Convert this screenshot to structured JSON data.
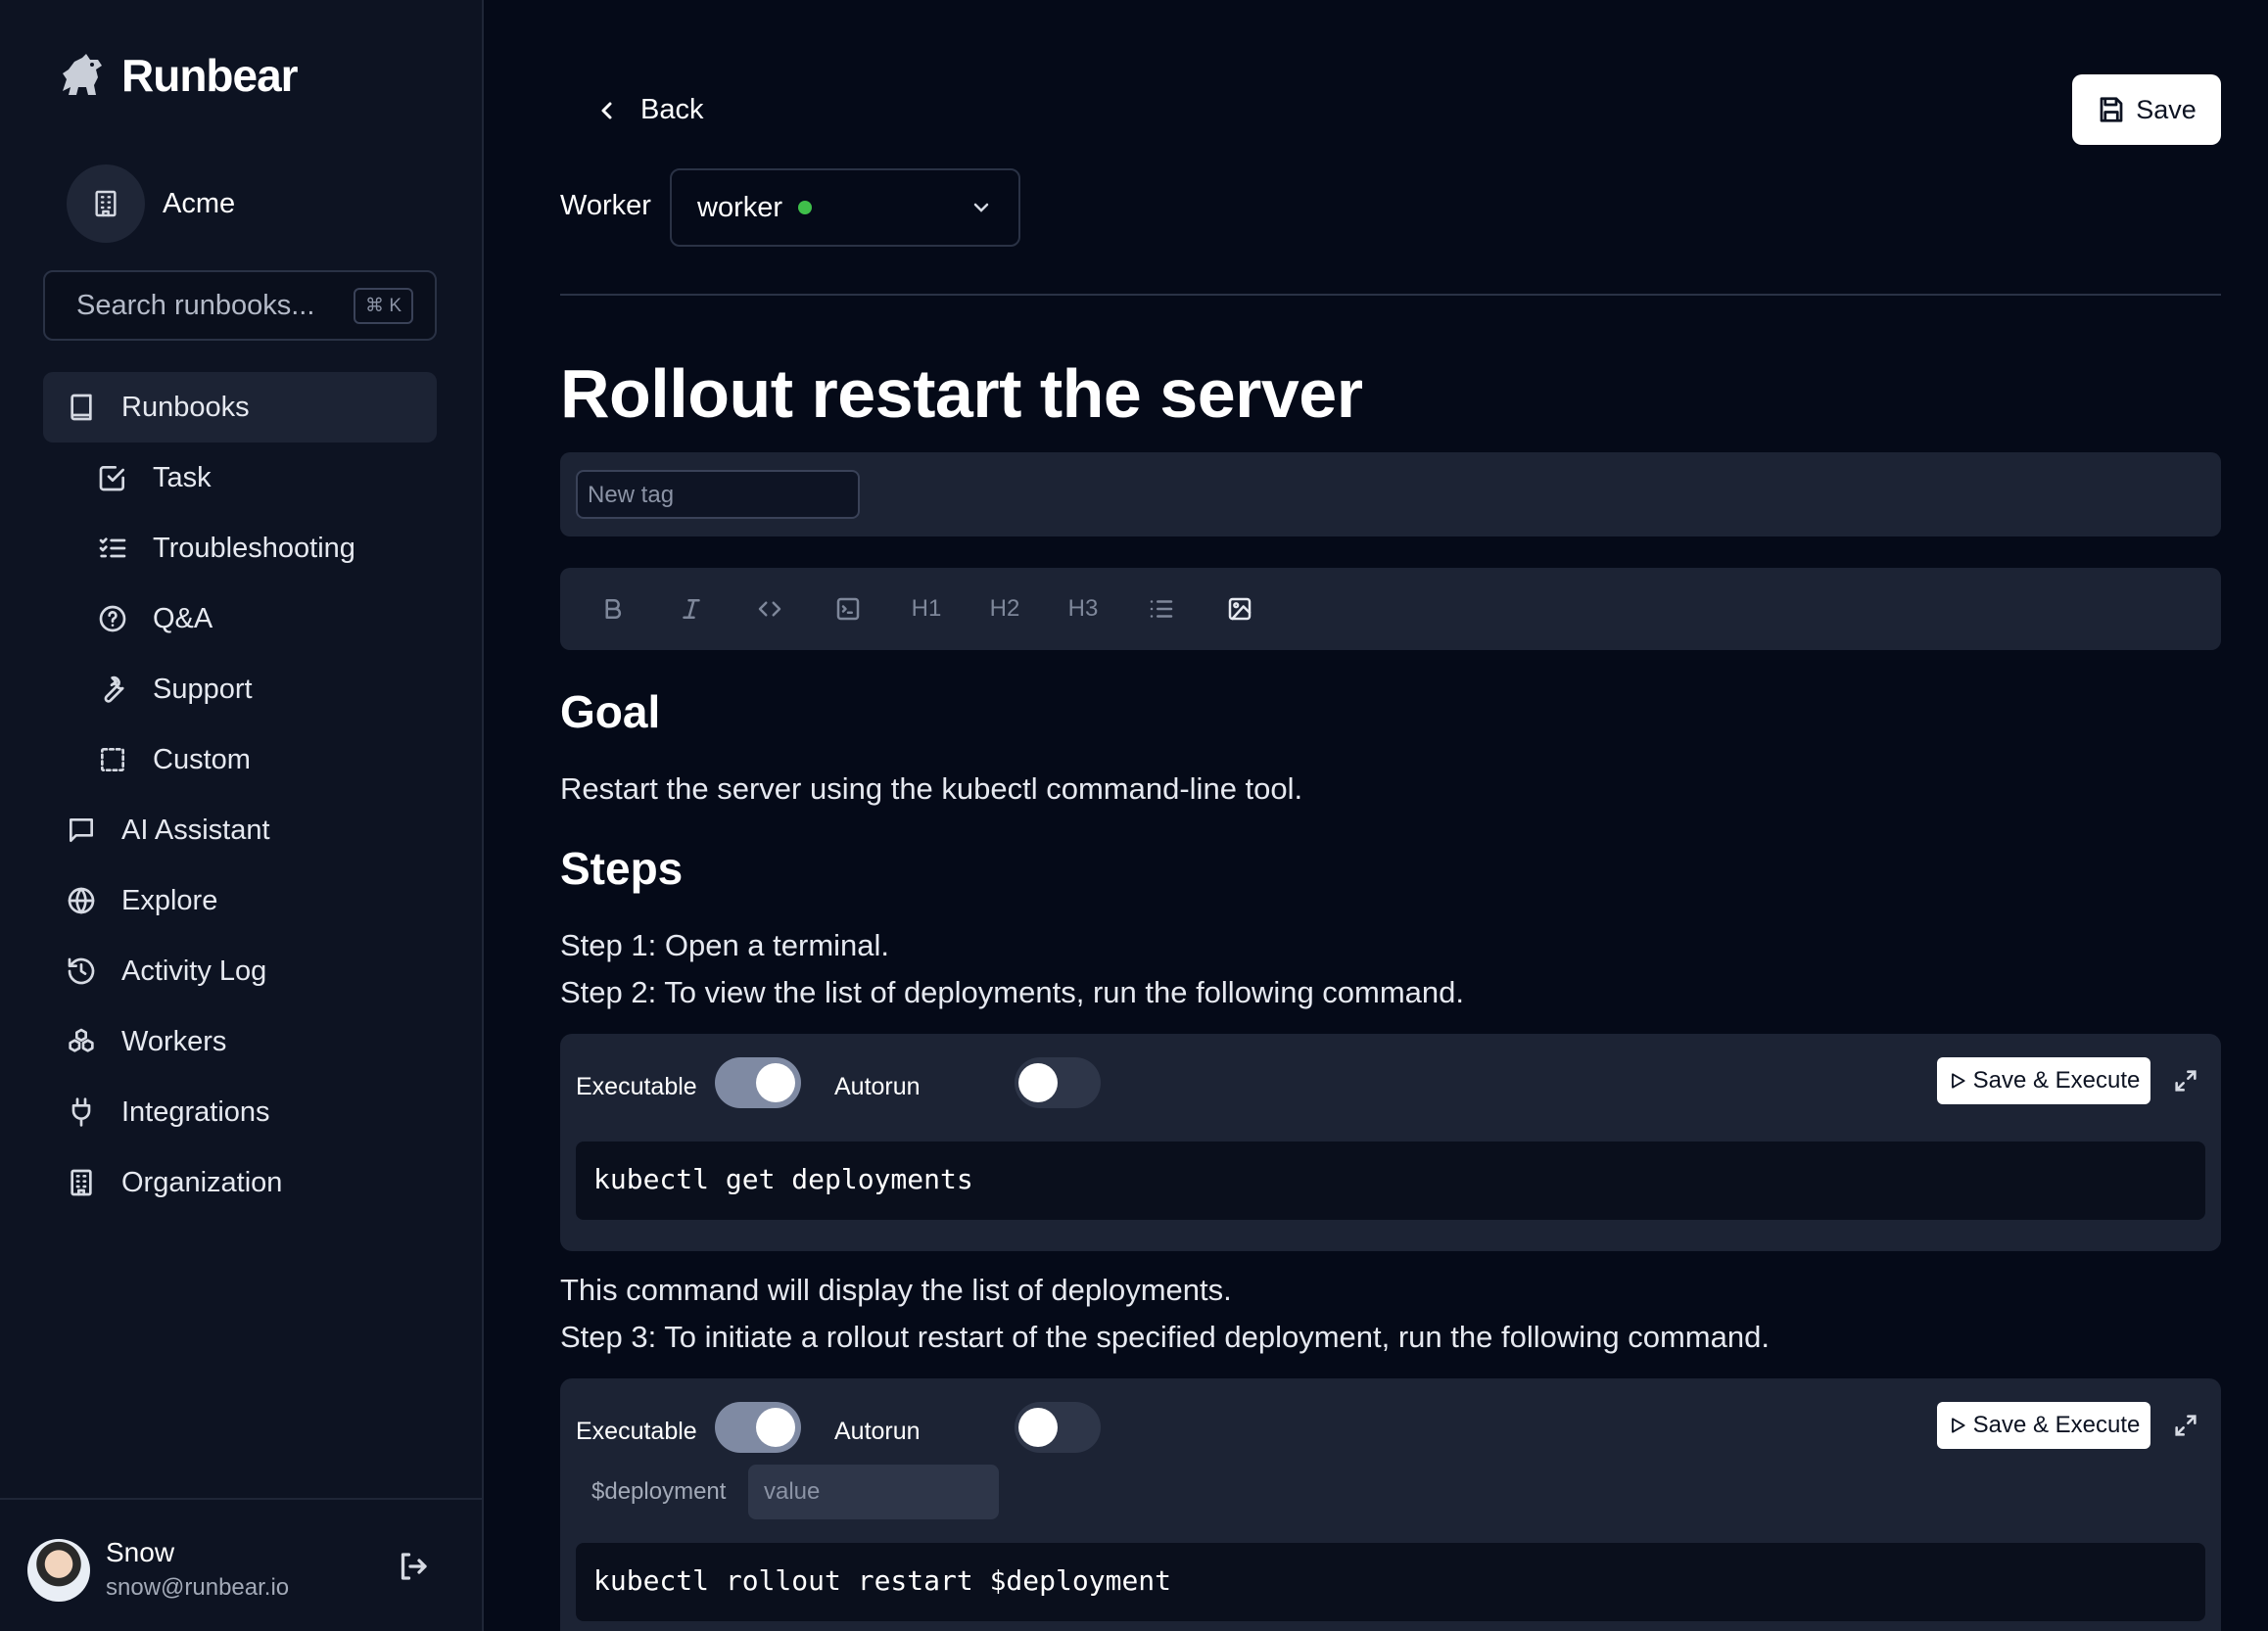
{
  "app": {
    "brand": "Runbear"
  },
  "sidebar": {
    "org_name": "Acme",
    "search": {
      "placeholder": "Search runbooks...",
      "shortcut": "⌘ K"
    },
    "items": [
      {
        "label": "Runbooks",
        "icon": "book-icon",
        "active": true
      },
      {
        "label": "Task",
        "icon": "checkbox-icon",
        "sub": true
      },
      {
        "label": "Troubleshooting",
        "icon": "list-checks-icon",
        "sub": true
      },
      {
        "label": "Q&A",
        "icon": "help-circle-icon",
        "sub": true
      },
      {
        "label": "Support",
        "icon": "wrench-icon",
        "sub": true
      },
      {
        "label": "Custom",
        "icon": "dashed-square-icon",
        "sub": true
      },
      {
        "label": "AI Assistant",
        "icon": "chat-icon"
      },
      {
        "label": "Explore",
        "icon": "globe-icon"
      },
      {
        "label": "Activity Log",
        "icon": "history-icon"
      },
      {
        "label": "Workers",
        "icon": "workers-icon"
      },
      {
        "label": "Integrations",
        "icon": "plug-icon"
      },
      {
        "label": "Organization",
        "icon": "building-icon"
      }
    ],
    "user": {
      "name": "Snow",
      "email": "snow@runbear.io"
    }
  },
  "header": {
    "back_label": "Back",
    "save_label": "Save",
    "worker_label": "Worker",
    "worker_value": "worker",
    "worker_status_color": "#3fbf4a"
  },
  "doc": {
    "title": "Rollout restart the server",
    "tag_placeholder": "New tag",
    "toolbar": [
      "bold-icon",
      "italic-icon",
      "code-icon",
      "terminal-icon",
      "H1",
      "H2",
      "H3",
      "bullet-list-icon",
      "image-icon"
    ],
    "goal_heading": "Goal",
    "goal_text": "Restart the server using the kubectl command-line tool.",
    "steps_heading": "Steps",
    "step1": "Step 1: Open a terminal.",
    "step2": "Step 2: To view the list of deployments, run the following command.",
    "after_step2": "This command will display the list of deployments.",
    "step3": "Step 3: To initiate a rollout restart of the specified deployment, run the following command.",
    "code_blocks": [
      {
        "executable_label": "Executable",
        "executable": true,
        "autorun_label": "Autorun",
        "autorun": false,
        "button_label": "Save & Execute",
        "code": "kubectl get deployments"
      },
      {
        "executable_label": "Executable",
        "executable": true,
        "autorun_label": "Autorun",
        "autorun": false,
        "button_label": "Save & Execute",
        "variable_name": "$deployment",
        "variable_placeholder": "value",
        "code": "kubectl rollout restart $deployment"
      }
    ]
  },
  "colors": {
    "background": "#050a18",
    "sidebar": "#0d1322",
    "panel": "#1c2334",
    "accent_white": "#ffffff"
  }
}
